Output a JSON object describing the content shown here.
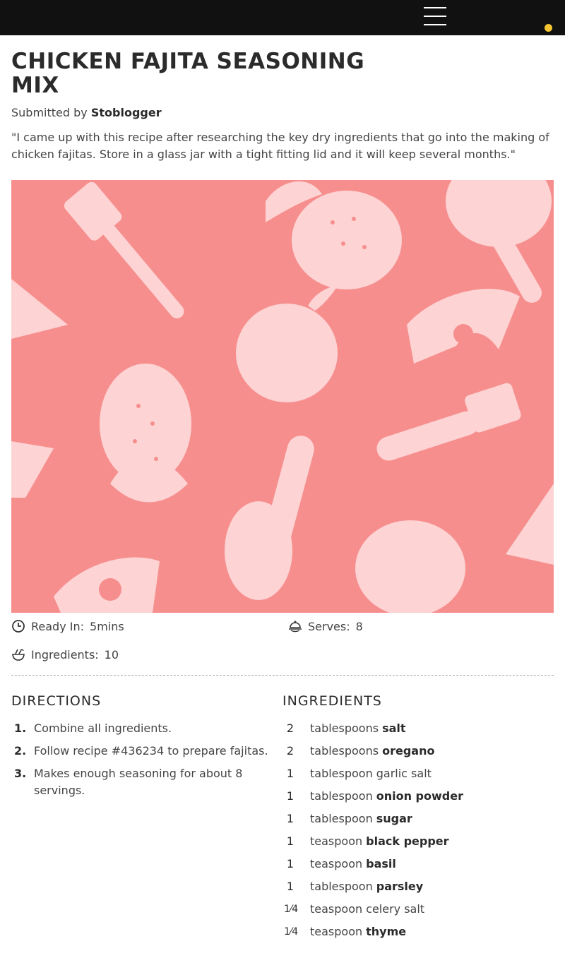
{
  "header": {
    "menu_icon": "hamburger-menu-icon",
    "notification_color": "#f4c531"
  },
  "recipe": {
    "title": "CHICKEN FAJITA SEASONING MIX",
    "submitted_prefix": "Submitted by",
    "author": "Stoblogger",
    "description": "\"I came up with this recipe after researching the key dry ingredients that go into the making of chicken fajitas. Store in a glass jar with a tight fitting lid and it will keep several months.\"",
    "hero_image": "placeholder-food-pattern",
    "hero_color": "#f78e8e"
  },
  "meta": {
    "ready_label": "Ready In:",
    "ready_value": "5mins",
    "serves_label": "Serves:",
    "serves_value": "8",
    "ingredients_label": "Ingredients:",
    "ingredients_value": "10"
  },
  "directions": {
    "title": "DIRECTIONS",
    "steps": [
      {
        "num": "1.",
        "text": "Combine all ingredients."
      },
      {
        "num": "2.",
        "text": "Follow recipe #436234 to prepare fajitas."
      },
      {
        "num": "3.",
        "text": "Makes enough seasoning for about 8 servings."
      }
    ]
  },
  "ingredients": {
    "title": "INGREDIENTS",
    "items": [
      {
        "qty": "2",
        "unit": "tablespoons",
        "name": "salt",
        "bold": true
      },
      {
        "qty": "2",
        "unit": "tablespoons",
        "name": "oregano",
        "bold": true
      },
      {
        "qty": "1",
        "unit": "tablespoon",
        "name": "garlic salt",
        "bold": false
      },
      {
        "qty": "1",
        "unit": "tablespoon",
        "name": "onion powder",
        "bold": true
      },
      {
        "qty": "1",
        "unit": "tablespoon",
        "name": "sugar",
        "bold": true
      },
      {
        "qty": "1",
        "unit": "teaspoon",
        "name": "black pepper",
        "bold": true
      },
      {
        "qty": "1",
        "unit": "teaspoon",
        "name": "basil",
        "bold": true
      },
      {
        "qty": "1",
        "unit": "tablespoon",
        "name": "parsley",
        "bold": true
      },
      {
        "qty": "1⁄4",
        "unit": "teaspoon",
        "name": "celery salt",
        "bold": false
      },
      {
        "qty": "1⁄4",
        "unit": "teaspoon",
        "name": "thyme",
        "bold": true
      }
    ]
  }
}
